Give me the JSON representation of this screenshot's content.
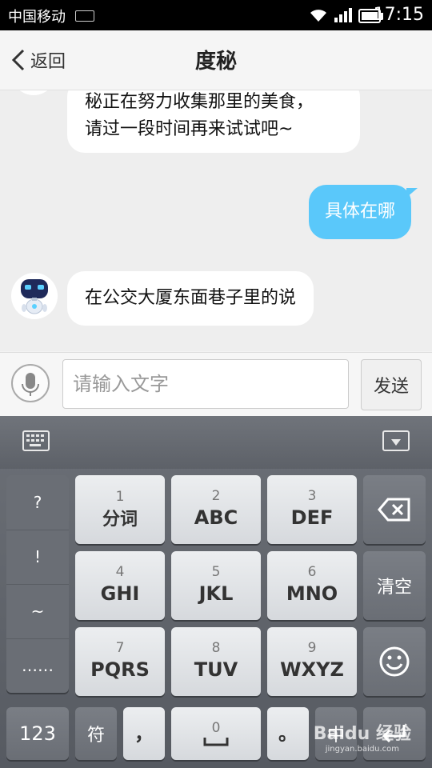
{
  "status_bar": {
    "carrier": "中国移动",
    "time": "17:15"
  },
  "nav": {
    "back_label": "返回",
    "title": "度秘"
  },
  "messages": [
    {
      "from": "bot",
      "text": "秘正在努力收集那里的美食，\n请过一段时间再来试试吧~"
    },
    {
      "from": "user",
      "text": "具体在哪"
    },
    {
      "from": "bot",
      "text": "在公交大厦东面巷子里的说"
    }
  ],
  "input": {
    "placeholder": "请输入文字",
    "value": "",
    "send_label": "发送"
  },
  "keyboard": {
    "symbols": [
      "?",
      "!",
      "~",
      "……"
    ],
    "keys": [
      {
        "num": "1",
        "label": "分词"
      },
      {
        "num": "2",
        "label": "ABC"
      },
      {
        "num": "3",
        "label": "DEF"
      },
      {
        "num": "4",
        "label": "GHI"
      },
      {
        "num": "5",
        "label": "JKL"
      },
      {
        "num": "6",
        "label": "MNO"
      },
      {
        "num": "7",
        "label": "PQRS"
      },
      {
        "num": "8",
        "label": "TUV"
      },
      {
        "num": "9",
        "label": "WXYZ"
      }
    ],
    "clear_label": "清空",
    "bottom": {
      "k123": "123",
      "fu": "符",
      "comma": "，",
      "zero": "0",
      "period": "。",
      "zhong": "中"
    }
  },
  "watermark": {
    "main": "Baidu 经验",
    "sub": "jingyan.baidu.com"
  },
  "colors": {
    "user_bubble": "#5ac8fa",
    "keyboard_bg": "#5f6369"
  }
}
